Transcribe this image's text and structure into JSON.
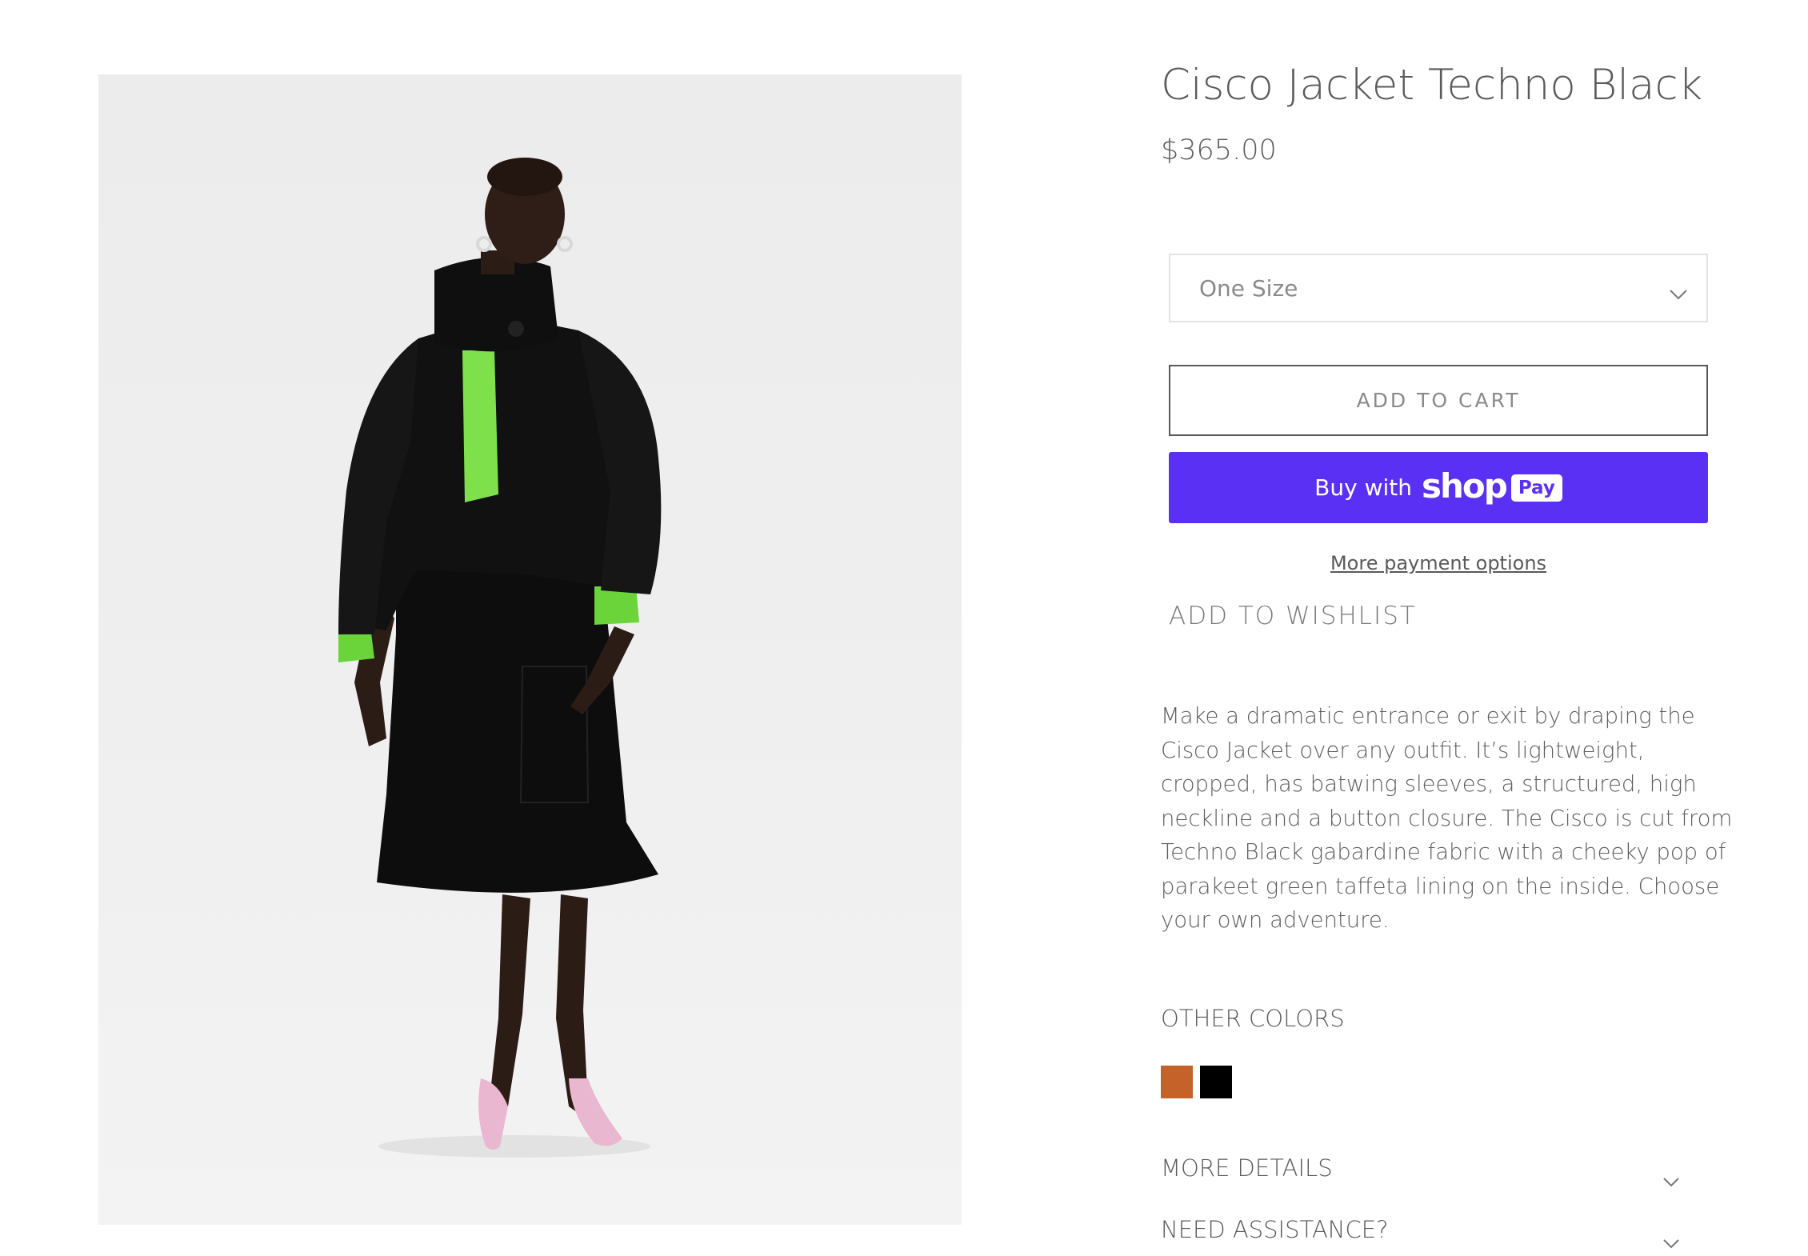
{
  "product": {
    "title": "Cisco Jacket Techno Black",
    "price": "$365.00",
    "image_alt": "Model wearing the Cisco Jacket in Techno Black with green lining, black skirt and pink heels"
  },
  "size_select": {
    "selected": "One Size",
    "icon": "chevron-down-icon"
  },
  "buttons": {
    "add_to_cart": "ADD TO CART",
    "buy_with": "Buy with",
    "shop_word": "shop",
    "pay_badge": "Pay",
    "more_payment": "More payment options",
    "wishlist": "ADD TO WISHLIST"
  },
  "description": "Make a dramatic entrance or exit by draping the Cisco Jacket over any outfit. It’s lightweight, cropped, has batwing sleeves, a structured, high neckline and a button closure. The Cisco is cut from Techno Black gabardine fabric with a cheeky pop of parakeet green taffeta lining on the inside. Choose your own adventure.",
  "other_colors": {
    "label": "OTHER COLORS",
    "swatches": [
      {
        "name": "rust",
        "color": "#c5622a"
      },
      {
        "name": "black",
        "color": "#000000"
      }
    ]
  },
  "accordions": {
    "more_details": "MORE DETAILS",
    "need_assistance": "NEED ASSISTANCE?"
  },
  "colors": {
    "shop_pay": "#5a31f4",
    "text": "#5a5a5a"
  }
}
